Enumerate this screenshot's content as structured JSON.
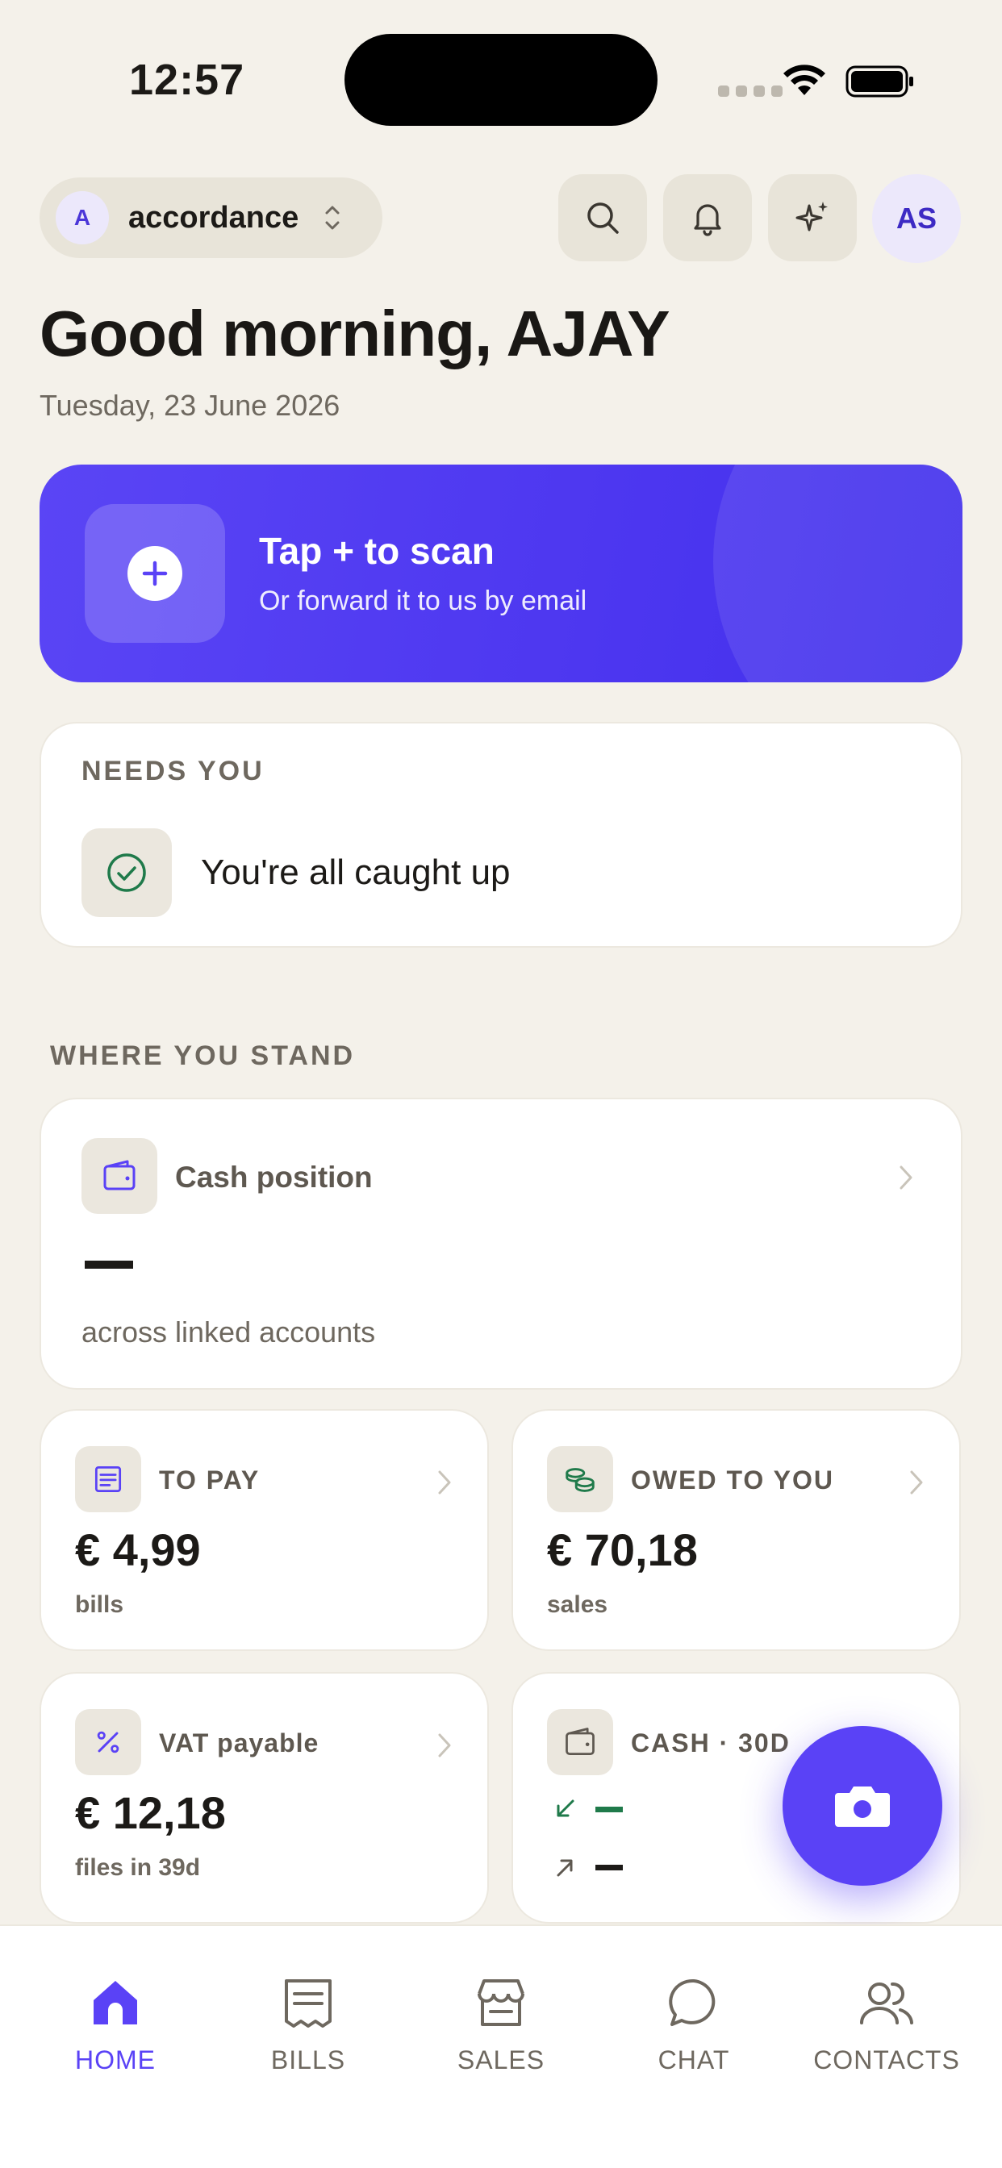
{
  "status_bar": {
    "time": "12:57"
  },
  "header": {
    "org_initial": "A",
    "org_name": "accordance",
    "user_initials": "AS",
    "icons": [
      "search-icon",
      "bell-icon",
      "sparkle-icon"
    ]
  },
  "greeting": "Good morning, AJAY",
  "date": "Tuesday, 23 June 2026",
  "scan": {
    "title": "Tap + to scan",
    "subtitle": "Or forward it to us by email"
  },
  "needs_you": {
    "label": "NEEDS YOU",
    "message": "You're all caught up"
  },
  "where_you_stand": {
    "label": "WHERE YOU STAND",
    "cash_position": {
      "title": "Cash position",
      "value": "—",
      "subtitle": "across linked accounts"
    },
    "to_pay": {
      "title": "TO PAY",
      "value": "€ 4,99",
      "subtitle": "bills"
    },
    "owed_to_you": {
      "title": "OWED TO YOU",
      "value": "€ 70,18",
      "subtitle": "sales"
    },
    "vat_payable": {
      "title": "VAT payable",
      "value": "€ 12,18",
      "subtitle": "files in 39d"
    },
    "cash_30d": {
      "title": "CASH · 30D",
      "inflow": "—",
      "outflow": "—"
    }
  },
  "colors": {
    "accent": "#5a42f6",
    "background": "#f4f1ea",
    "inflow": "#1f7a4a",
    "outflow": "#1c1a17"
  },
  "tabs": [
    {
      "label": "HOME",
      "icon": "home-icon",
      "active": true
    },
    {
      "label": "BILLS",
      "icon": "receipt-icon",
      "active": false
    },
    {
      "label": "SALES",
      "icon": "store-icon",
      "active": false
    },
    {
      "label": "CHAT",
      "icon": "chat-icon",
      "active": false
    },
    {
      "label": "CONTACTS",
      "icon": "contacts-icon",
      "active": false
    }
  ]
}
